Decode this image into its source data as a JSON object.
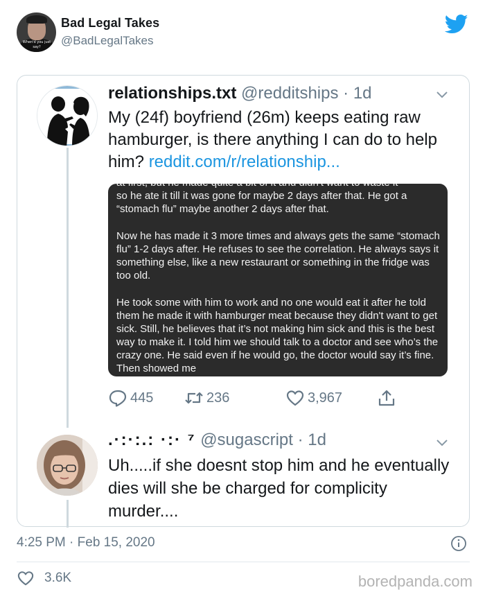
{
  "author": {
    "name": "Bad Legal Takes",
    "handle": "@BadLegalTakes",
    "avatar_caption": "When'd you just say?"
  },
  "quoted_tweet": {
    "name": "relationships.txt",
    "handle": "@redditships",
    "age": "· 1d",
    "text": "My (24f) boyfriend (26m) keeps eating raw hamburger, is there anything I can do to help him? ",
    "link": "reddit.com/r/relationship...",
    "screenshot": {
      "cut_line": "at first, but he made quite a bit of it and didn't want to waste it",
      "para1": "so he ate it till it was gone for maybe 2 days after that. He got a “stomach flu” maybe another 2 days after that.",
      "para2": "Now he has made it 3 more times and always gets the same “stomach flu” 1-2 days after. He refuses to see the correlation. He always says it something else, like a new restaurant or something in the fridge was too old.",
      "para3": "He took some with him to work and no one would eat it after he told them he made it with hamburger meat because they didn't want to get sick. Still, he believes that it’s not making him sick and this is the best way to make it. I told him we should talk to a doctor and see who’s the crazy one. He said even if he would go, the doctor would say it’s fine. Then showed me"
    },
    "replies": "445",
    "retweets": "236",
    "likes": "3,967"
  },
  "reply_tweet": {
    "name": ".·:·:.:  ·:· ⁷",
    "handle": "@sugascript",
    "age": "· 1d",
    "text": "Uh.....if she doesnt stop him and he eventually dies will she be charged for complicity murder...."
  },
  "timestamp": "4:25 PM · Feb 15, 2020",
  "like_count": "3.6K",
  "watermark": "boredpanda.com",
  "colors": {
    "twitter_blue": "#1da1f2",
    "link": "#1b95e0",
    "muted": "#657786",
    "dark_image_bg": "#2b2b2b"
  },
  "icons": [
    "twitter-bird-icon",
    "chevron-down-icon",
    "reply-icon",
    "retweet-icon",
    "heart-icon",
    "share-icon",
    "info-icon"
  ]
}
